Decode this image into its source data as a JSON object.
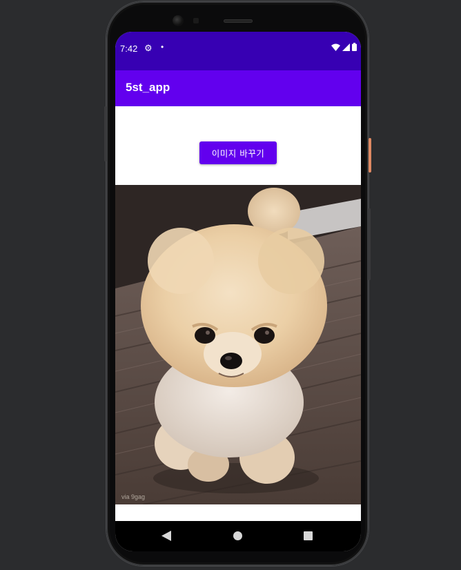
{
  "status": {
    "time": "7:42",
    "icons": [
      "settings-gear-icon",
      "notification-dot-icon",
      "wifi-icon",
      "cell-signal-icon",
      "battery-icon"
    ]
  },
  "app": {
    "title": "5st_app",
    "primary_color": "#6200ee",
    "status_bar_color": "#3700b3"
  },
  "main": {
    "change_button_label": "이미지 바꾸기",
    "image": {
      "subject": "pomeranian-puppy",
      "watermark": "via 9gag"
    }
  },
  "nav": {
    "icons": [
      "back-icon",
      "home-icon",
      "recents-icon"
    ]
  }
}
